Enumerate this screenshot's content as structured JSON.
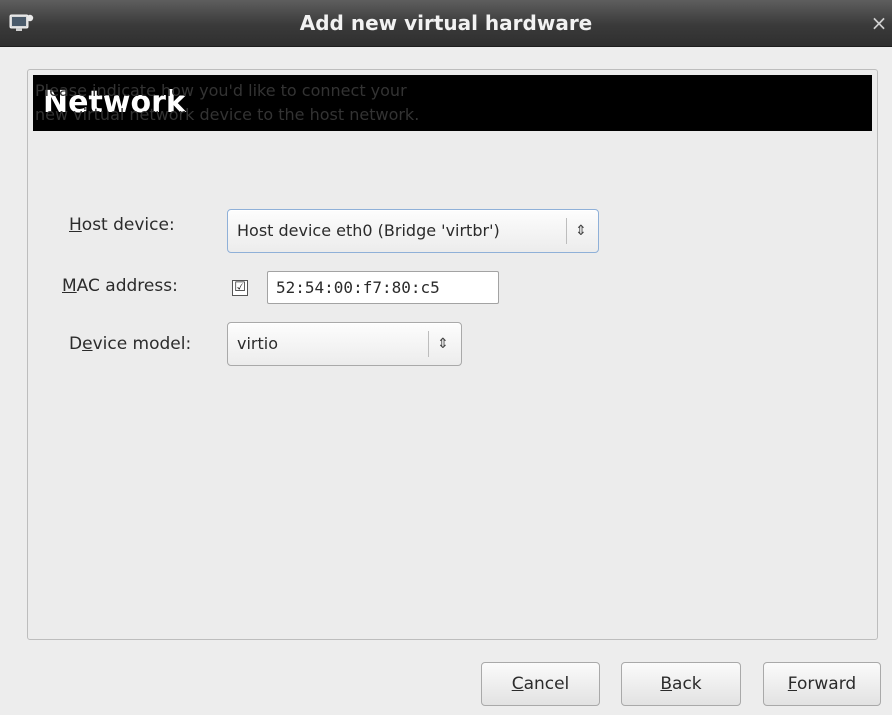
{
  "window": {
    "title": "Add new virtual hardware",
    "app_icon": "monitor-network-icon",
    "close_glyph": "×"
  },
  "page": {
    "heading": "Network",
    "intro_line1": "Please indicate how you'd like to connect your",
    "intro_line2": "new virtual network device to the host network."
  },
  "form": {
    "host_device": {
      "label_mnemonic": "H",
      "label_rest": "ost device:",
      "value": "Host device eth0 (Bridge 'virtbr')"
    },
    "mac_address": {
      "label_mnemonic": "M",
      "label_rest": "AC address:",
      "checked": true,
      "checkmark": "☑",
      "value": "52:54:00:f7:80:c5"
    },
    "device_model": {
      "label_pre": "D",
      "label_mnemonic": "e",
      "label_rest": "vice model:",
      "value": "virtio"
    },
    "combo_arrows": "⇕"
  },
  "buttons": {
    "cancel": {
      "mnemonic": "C",
      "rest": "ancel"
    },
    "back": {
      "mnemonic": "B",
      "rest": "ack"
    },
    "forward": {
      "mnemonic": "F",
      "rest": "orward"
    }
  }
}
